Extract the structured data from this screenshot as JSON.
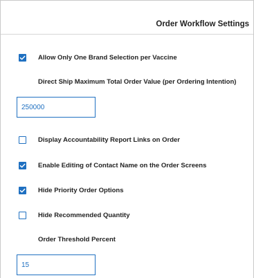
{
  "header": {
    "title": "Order Workflow Settings"
  },
  "colors": {
    "accent": "#1f70c1",
    "border": "#c9c9c9"
  },
  "settings": {
    "brand_selection": {
      "label": "Allow Only One Brand Selection per Vaccine",
      "checked": true
    },
    "direct_ship": {
      "label": "Direct Ship Maximum Total Order Value (per Ordering Intention)",
      "value": "250000"
    },
    "accountability_links": {
      "label": "Display Accountability Report Links on Order",
      "checked": false
    },
    "contact_name_editing": {
      "label": "Enable Editing of Contact Name on the Order Screens",
      "checked": true
    },
    "hide_priority": {
      "label": "Hide Priority Order Options",
      "checked": true
    },
    "hide_recommended": {
      "label": "Hide Recommended Quantity",
      "checked": false
    },
    "order_threshold": {
      "label": "Order Threshold Percent",
      "value": "15"
    }
  },
  "icons": {
    "checked": "checkmark-icon"
  }
}
